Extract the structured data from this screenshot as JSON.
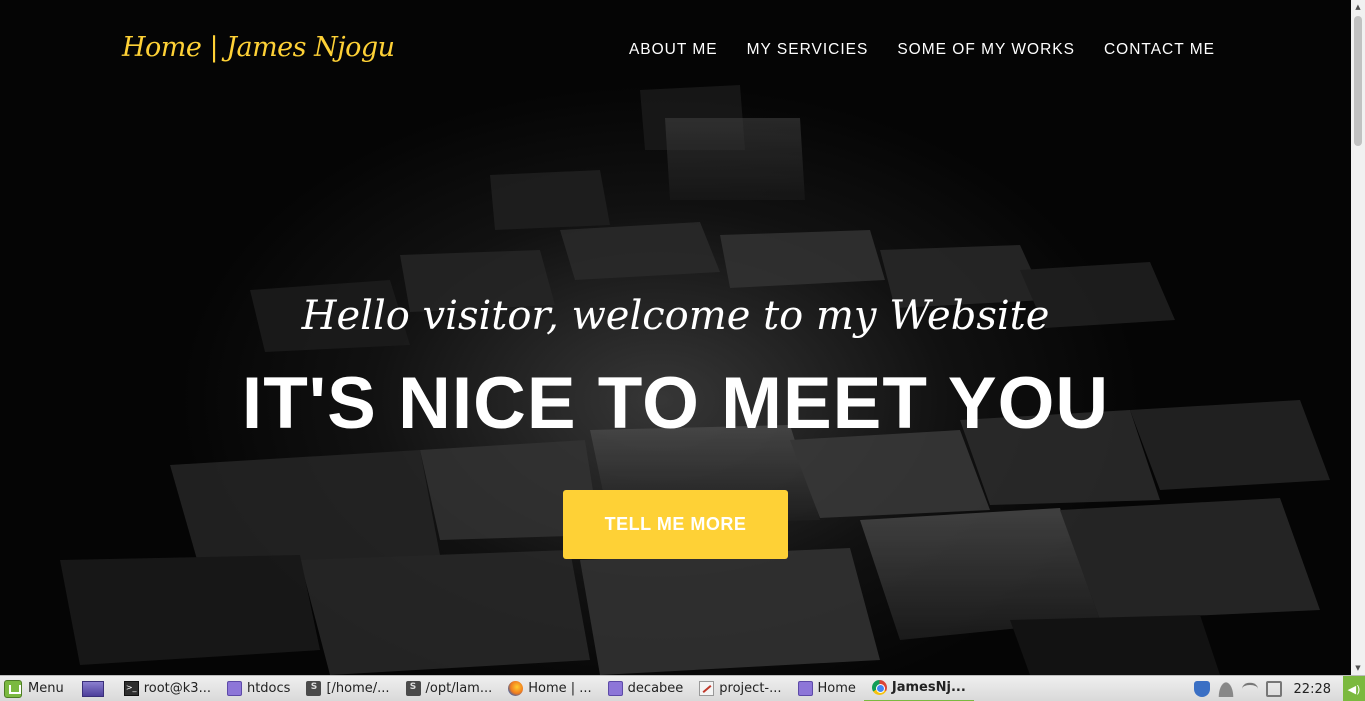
{
  "navbar": {
    "brand": "Home | James Njogu",
    "links": [
      "ABOUT ME",
      "MY SERVICIES",
      "SOME OF MY WORKS",
      "CONTACT ME"
    ]
  },
  "hero": {
    "lead": "Hello visitor, welcome to my Website",
    "heading": "IT'S NICE TO MEET YOU",
    "button": "TELL ME MORE"
  },
  "colors": {
    "accent": "#fed136",
    "background": "#000000",
    "text": "#ffffff"
  },
  "taskbar": {
    "menu_label": "Menu",
    "items": [
      {
        "label": "root@k3...",
        "icon": "terminal-icon"
      },
      {
        "label": "htdocs",
        "icon": "folder-icon"
      },
      {
        "label": "[/home/...",
        "icon": "sublime-icon"
      },
      {
        "label": "/opt/lam...",
        "icon": "sublime-icon"
      },
      {
        "label": "Home | ...",
        "icon": "firefox-icon"
      },
      {
        "label": "decabee",
        "icon": "folder-icon"
      },
      {
        "label": "project-...",
        "icon": "image-viewer-icon"
      },
      {
        "label": "Home",
        "icon": "folder-icon"
      },
      {
        "label": "JamesNj...",
        "icon": "chrome-icon",
        "active": true
      }
    ],
    "clock": "22:28"
  }
}
